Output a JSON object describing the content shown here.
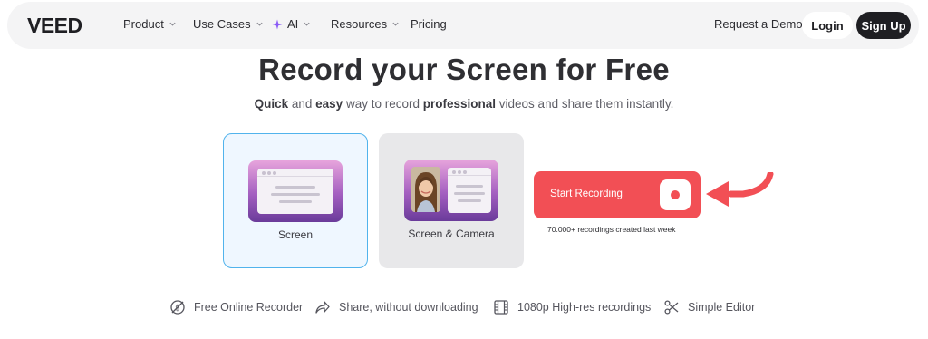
{
  "brand": {
    "logo_text": "VEED"
  },
  "nav": {
    "items": [
      {
        "label": "Product",
        "has_dropdown": true
      },
      {
        "label": "Use Cases",
        "has_dropdown": true
      },
      {
        "label": "AI",
        "has_dropdown": true,
        "icon": "sparkle-icon"
      },
      {
        "label": "Resources",
        "has_dropdown": true
      },
      {
        "label": "Pricing",
        "has_dropdown": false
      }
    ],
    "request_demo": "Request a Demo",
    "login": "Login",
    "signup": "Sign Up"
  },
  "hero": {
    "title": "Record your Screen for Free",
    "subtitle_parts": {
      "w1": "Quick",
      "t1": " and ",
      "w2": "easy",
      "t2": " way to record ",
      "w3": "professional",
      "t3": " videos and share them instantly."
    }
  },
  "modes": [
    {
      "label": "Screen",
      "selected": true
    },
    {
      "label": "Screen & Camera",
      "selected": false
    }
  ],
  "record": {
    "button_label": "Start Recording",
    "count_text": "70.000+ recordings created last week"
  },
  "features": [
    {
      "label": "Free Online Recorder",
      "icon": "no-cost-icon"
    },
    {
      "label": "Share, without downloading",
      "icon": "share-arrow-icon"
    },
    {
      "label": "1080p High-res recordings",
      "icon": "film-icon"
    },
    {
      "label": "Simple Editor",
      "icon": "scissors-icon"
    }
  ],
  "colors": {
    "accent_red": "#f24f55",
    "selected_border": "#51b3ec",
    "dark": "#1f1f23"
  }
}
